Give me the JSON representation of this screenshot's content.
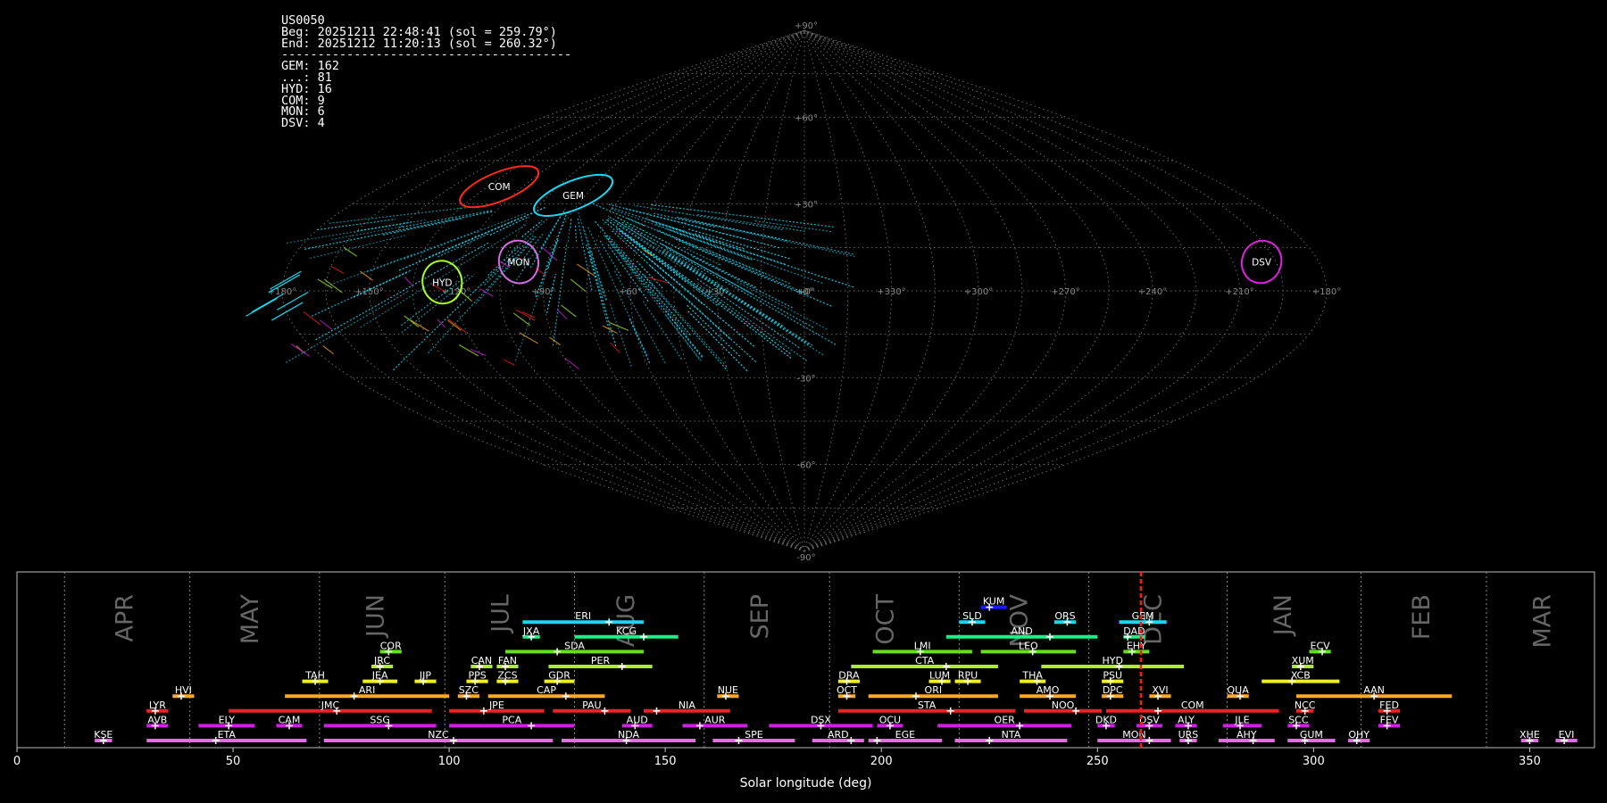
{
  "header": {
    "station": "US0050",
    "begin": "Beg: 20251211 22:48:41 (sol = 259.79°)",
    "end": "End: 20251212 11:20:13 (sol = 260.32°)",
    "separator": "----------------------------------------",
    "counts": [
      {
        "code": "GEM",
        "count": 162
      },
      {
        "code": "...",
        "count": 81
      },
      {
        "code": "HYD",
        "count": 16
      },
      {
        "code": "COM",
        "count": 9
      },
      {
        "code": "MON",
        "count": 6
      },
      {
        "code": "DSV",
        "count": 4
      }
    ]
  },
  "sky_map": {
    "projection": "sinusoidal",
    "center_lon_label": "+0°",
    "lon_labels": [
      "+180°",
      "+150°",
      "+120°",
      "+90°",
      "+60°",
      "+30°",
      "+0°",
      "+330°",
      "+300°",
      "+270°",
      "+240°",
      "+210°",
      "+180°"
    ],
    "lat_labels": [
      "+90°",
      "+60°",
      "+30°",
      "+0°",
      "-30°",
      "-60°",
      "-90°"
    ],
    "radiants": [
      {
        "code": "COM",
        "lon": 130,
        "lat": 36,
        "color": "#ff2a1a"
      },
      {
        "code": "GEM",
        "lon": 95,
        "lat": 33,
        "color": "#1ad7f0"
      },
      {
        "code": "MON",
        "lon": 100,
        "lat": 10,
        "color": "#d070e0"
      },
      {
        "code": "HYD",
        "lon": 125,
        "lat": 3,
        "color": "#aaff22"
      },
      {
        "code": "DSV",
        "lon": 200,
        "lat": 10,
        "color": "#e020e0"
      }
    ]
  },
  "chart_data": {
    "type": "gantt",
    "xlabel": "Solar longitude (deg)",
    "xlim": [
      0,
      365
    ],
    "xticks": [
      0,
      50,
      100,
      150,
      200,
      250,
      300,
      350
    ],
    "current_sol": 260.05,
    "months": [
      {
        "name": "APR",
        "sol": 25
      },
      {
        "name": "MAY",
        "sol": 54
      },
      {
        "name": "JUN",
        "sol": 83
      },
      {
        "name": "JUL",
        "sol": 112
      },
      {
        "name": "AUG",
        "sol": 141
      },
      {
        "name": "SEP",
        "sol": 172
      },
      {
        "name": "OCT",
        "sol": 201
      },
      {
        "name": "NOV",
        "sol": 232
      },
      {
        "name": "DEC",
        "sol": 263
      },
      {
        "name": "JAN",
        "sol": 293
      },
      {
        "name": "FEB",
        "sol": 325
      },
      {
        "name": "MAR",
        "sol": 353
      }
    ],
    "month_dividers": [
      11,
      40,
      70,
      99,
      129,
      159,
      188,
      218,
      248,
      280,
      311,
      340
    ],
    "showers": [
      {
        "code": "KUM",
        "start": 223,
        "end": 229,
        "peak": 225,
        "row": 9,
        "color": "#1a1aff"
      },
      {
        "code": "ERI",
        "start": 117,
        "end": 145,
        "peak": 137,
        "row": 8,
        "color": "#1ad7f0"
      },
      {
        "code": "SLD",
        "start": 218,
        "end": 224,
        "peak": 221,
        "row": 8,
        "color": "#1ad7f0"
      },
      {
        "code": "ORS",
        "start": 240,
        "end": 245,
        "peak": 243,
        "row": 8,
        "color": "#1ad7f0"
      },
      {
        "code": "GEM",
        "start": 255,
        "end": 266,
        "peak": 262,
        "row": 8,
        "color": "#1ad7f0"
      },
      {
        "code": "JXA",
        "start": 117,
        "end": 121,
        "peak": 119,
        "row": 7,
        "color": "#22ee88"
      },
      {
        "code": "KCG",
        "start": 129,
        "end": 153,
        "peak": 145,
        "row": 7,
        "color": "#22ee88"
      },
      {
        "code": "AND",
        "start": 215,
        "end": 250,
        "peak": 239,
        "row": 7,
        "color": "#22ee88"
      },
      {
        "code": "DAD",
        "start": 256,
        "end": 261,
        "peak": 257,
        "row": 7,
        "color": "#22ee88"
      },
      {
        "code": "COR",
        "start": 84,
        "end": 89,
        "peak": 86,
        "row": 6,
        "color": "#66dd22"
      },
      {
        "code": "SDA",
        "start": 113,
        "end": 145,
        "peak": 125,
        "row": 6,
        "color": "#66dd22"
      },
      {
        "code": "LMI",
        "start": 198,
        "end": 221,
        "peak": 209,
        "row": 6,
        "color": "#66dd22"
      },
      {
        "code": "LEO",
        "start": 223,
        "end": 245,
        "peak": 235,
        "row": 6,
        "color": "#66dd22"
      },
      {
        "code": "EHY",
        "start": 256,
        "end": 262,
        "peak": 258,
        "row": 6,
        "color": "#66dd22"
      },
      {
        "code": "ECV",
        "start": 299,
        "end": 304,
        "peak": 302,
        "row": 6,
        "color": "#66dd22"
      },
      {
        "code": "JRC",
        "start": 82,
        "end": 87,
        "peak": 84,
        "row": 5,
        "color": "#aaee33"
      },
      {
        "code": "CAN",
        "start": 105,
        "end": 110,
        "peak": 107,
        "row": 5,
        "color": "#aaee33"
      },
      {
        "code": "FAN",
        "start": 111,
        "end": 116,
        "peak": 113,
        "row": 5,
        "color": "#aaee33"
      },
      {
        "code": "PER",
        "start": 123,
        "end": 147,
        "peak": 140,
        "row": 5,
        "color": "#aaee33"
      },
      {
        "code": "CTA",
        "start": 193,
        "end": 227,
        "peak": 215,
        "row": 5,
        "color": "#aaee33"
      },
      {
        "code": "HYD",
        "start": 237,
        "end": 270,
        "peak": 255,
        "row": 5,
        "color": "#aaee33"
      },
      {
        "code": "XUM",
        "start": 295,
        "end": 300,
        "peak": 297,
        "row": 5,
        "color": "#aaee33"
      },
      {
        "code": "TAH",
        "start": 66,
        "end": 72,
        "peak": 69,
        "row": 4,
        "color": "#eeee22"
      },
      {
        "code": "JEA",
        "start": 80,
        "end": 88,
        "peak": 84,
        "row": 4,
        "color": "#eeee22"
      },
      {
        "code": "JIP",
        "start": 92,
        "end": 97,
        "peak": 94,
        "row": 4,
        "color": "#eeee22"
      },
      {
        "code": "PPS",
        "start": 104,
        "end": 109,
        "peak": 106,
        "row": 4,
        "color": "#eeee22"
      },
      {
        "code": "ZCS",
        "start": 111,
        "end": 116,
        "peak": 113,
        "row": 4,
        "color": "#eeee22"
      },
      {
        "code": "GDR",
        "start": 122,
        "end": 129,
        "peak": 125,
        "row": 4,
        "color": "#eeee22"
      },
      {
        "code": "DRA",
        "start": 190,
        "end": 195,
        "peak": 192,
        "row": 4,
        "color": "#eeee22"
      },
      {
        "code": "LUM",
        "start": 211,
        "end": 216,
        "peak": 214,
        "row": 4,
        "color": "#eeee22"
      },
      {
        "code": "RPU",
        "start": 217,
        "end": 223,
        "peak": 220,
        "row": 4,
        "color": "#eeee22"
      },
      {
        "code": "THA",
        "start": 232,
        "end": 238,
        "peak": 236,
        "row": 4,
        "color": "#eeee22"
      },
      {
        "code": "PSU",
        "start": 251,
        "end": 256,
        "peak": 253,
        "row": 4,
        "color": "#eeee22"
      },
      {
        "code": "XCB",
        "start": 288,
        "end": 306,
        "peak": 295,
        "row": 4,
        "color": "#eeee22"
      },
      {
        "code": "HVI",
        "start": 36,
        "end": 41,
        "peak": 38,
        "row": 3,
        "color": "#ffaa22"
      },
      {
        "code": "ARI",
        "start": 62,
        "end": 100,
        "peak": 78,
        "row": 3,
        "color": "#ffaa22"
      },
      {
        "code": "SZC",
        "start": 102,
        "end": 107,
        "peak": 104,
        "row": 3,
        "color": "#ffaa22"
      },
      {
        "code": "CAP",
        "start": 109,
        "end": 136,
        "peak": 127,
        "row": 3,
        "color": "#ffaa22"
      },
      {
        "code": "NUE",
        "start": 162,
        "end": 167,
        "peak": 164,
        "row": 3,
        "color": "#ffaa22"
      },
      {
        "code": "OCT",
        "start": 190,
        "end": 194,
        "peak": 192,
        "row": 3,
        "color": "#ffaa22"
      },
      {
        "code": "ORI",
        "start": 197,
        "end": 227,
        "peak": 208,
        "row": 3,
        "color": "#ffaa22"
      },
      {
        "code": "AMO",
        "start": 232,
        "end": 245,
        "peak": 239,
        "row": 3,
        "color": "#ffaa22"
      },
      {
        "code": "DPC",
        "start": 251,
        "end": 256,
        "peak": 253,
        "row": 3,
        "color": "#ffaa22"
      },
      {
        "code": "XVI",
        "start": 262,
        "end": 267,
        "peak": 264,
        "row": 3,
        "color": "#ffaa22"
      },
      {
        "code": "QUA",
        "start": 280,
        "end": 285,
        "peak": 283,
        "row": 3,
        "color": "#ffaa22"
      },
      {
        "code": "AAN",
        "start": 296,
        "end": 332,
        "peak": 314,
        "row": 3,
        "color": "#ffaa22"
      },
      {
        "code": "LYR",
        "start": 30,
        "end": 35,
        "peak": 32,
        "row": 2,
        "color": "#ee2222"
      },
      {
        "code": "JMC",
        "start": 49,
        "end": 96,
        "peak": 74,
        "row": 2,
        "color": "#ee2222"
      },
      {
        "code": "JPE",
        "start": 100,
        "end": 122,
        "peak": 108,
        "row": 2,
        "color": "#ee2222"
      },
      {
        "code": "PAU",
        "start": 124,
        "end": 142,
        "peak": 136,
        "row": 2,
        "color": "#ee2222"
      },
      {
        "code": "NIA",
        "start": 145,
        "end": 165,
        "peak": 148,
        "row": 2,
        "color": "#ee2222"
      },
      {
        "code": "STA",
        "start": 190,
        "end": 231,
        "peak": 216,
        "row": 2,
        "color": "#ee2222"
      },
      {
        "code": "NOO",
        "start": 233,
        "end": 251,
        "peak": 245,
        "row": 2,
        "color": "#ee2222"
      },
      {
        "code": "COM",
        "start": 252,
        "end": 292,
        "peak": 264,
        "row": 2,
        "color": "#ee2222"
      },
      {
        "code": "NCC",
        "start": 296,
        "end": 300,
        "peak": 298,
        "row": 2,
        "color": "#ee2222"
      },
      {
        "code": "FED",
        "start": 315,
        "end": 320,
        "peak": 317,
        "row": 2,
        "color": "#ee2222"
      },
      {
        "code": "AVB",
        "start": 30,
        "end": 35,
        "peak": 32,
        "row": 1,
        "color": "#cc22dd"
      },
      {
        "code": "ELY",
        "start": 42,
        "end": 55,
        "peak": 49,
        "row": 1,
        "color": "#cc22dd"
      },
      {
        "code": "CAM",
        "start": 60,
        "end": 66,
        "peak": 63,
        "row": 1,
        "color": "#cc22dd"
      },
      {
        "code": "SSG",
        "start": 71,
        "end": 97,
        "peak": 86,
        "row": 1,
        "color": "#cc22dd"
      },
      {
        "code": "PCA",
        "start": 100,
        "end": 129,
        "peak": 119,
        "row": 1,
        "color": "#cc22dd"
      },
      {
        "code": "AUD",
        "start": 140,
        "end": 147,
        "peak": 143,
        "row": 1,
        "color": "#cc22dd"
      },
      {
        "code": "AUR",
        "start": 154,
        "end": 169,
        "peak": 158,
        "row": 1,
        "color": "#cc22dd"
      },
      {
        "code": "DSX",
        "start": 174,
        "end": 198,
        "peak": 186,
        "row": 1,
        "color": "#cc22dd"
      },
      {
        "code": "OCU",
        "start": 199,
        "end": 205,
        "peak": 202,
        "row": 1,
        "color": "#cc22dd"
      },
      {
        "code": "OER",
        "start": 213,
        "end": 244,
        "peak": 232,
        "row": 1,
        "color": "#cc22dd"
      },
      {
        "code": "DKD",
        "start": 250,
        "end": 254,
        "peak": 252,
        "row": 1,
        "color": "#cc22dd"
      },
      {
        "code": "DSV",
        "start": 259,
        "end": 265,
        "peak": 262,
        "row": 1,
        "color": "#cc22dd"
      },
      {
        "code": "ALY",
        "start": 268,
        "end": 273,
        "peak": 271,
        "row": 1,
        "color": "#cc22dd"
      },
      {
        "code": "JLE",
        "start": 279,
        "end": 288,
        "peak": 283,
        "row": 1,
        "color": "#cc22dd"
      },
      {
        "code": "SCC",
        "start": 294,
        "end": 299,
        "peak": 296,
        "row": 1,
        "color": "#cc22dd"
      },
      {
        "code": "FEV",
        "start": 315,
        "end": 320,
        "peak": 317,
        "row": 1,
        "color": "#cc22dd"
      },
      {
        "code": "KSE",
        "start": 18,
        "end": 22,
        "peak": 20,
        "row": 0,
        "color": "#ee66ee"
      },
      {
        "code": "ETA",
        "start": 30,
        "end": 67,
        "peak": 46,
        "row": 0,
        "color": "#ee66ee"
      },
      {
        "code": "NZC",
        "start": 71,
        "end": 124,
        "peak": 101,
        "row": 0,
        "color": "#ee66ee"
      },
      {
        "code": "NDA",
        "start": 126,
        "end": 157,
        "peak": 141,
        "row": 0,
        "color": "#ee66ee"
      },
      {
        "code": "SPE",
        "start": 161,
        "end": 180,
        "peak": 167,
        "row": 0,
        "color": "#ee66ee"
      },
      {
        "code": "ARD",
        "start": 184,
        "end": 196,
        "peak": 193,
        "row": 0,
        "color": "#ee66ee"
      },
      {
        "code": "EGE",
        "start": 197,
        "end": 214,
        "peak": 199,
        "row": 0,
        "color": "#ee66ee"
      },
      {
        "code": "NTA",
        "start": 217,
        "end": 243,
        "peak": 225,
        "row": 0,
        "color": "#ee66ee"
      },
      {
        "code": "MON",
        "start": 250,
        "end": 267,
        "peak": 262,
        "row": 0,
        "color": "#ee66ee"
      },
      {
        "code": "URS",
        "start": 269,
        "end": 273,
        "peak": 271,
        "row": 0,
        "color": "#ee66ee"
      },
      {
        "code": "AHY",
        "start": 278,
        "end": 291,
        "peak": 286,
        "row": 0,
        "color": "#ee66ee"
      },
      {
        "code": "GUM",
        "start": 294,
        "end": 305,
        "peak": 298,
        "row": 0,
        "color": "#ee66ee"
      },
      {
        "code": "OHY",
        "start": 308,
        "end": 313,
        "peak": 310,
        "row": 0,
        "color": "#ee66ee"
      },
      {
        "code": "XHE",
        "start": 348,
        "end": 352,
        "peak": 350,
        "row": 0,
        "color": "#ee66ee"
      },
      {
        "code": "EVI",
        "start": 356,
        "end": 361,
        "peak": 358,
        "row": 0,
        "color": "#ee66ee"
      }
    ]
  }
}
